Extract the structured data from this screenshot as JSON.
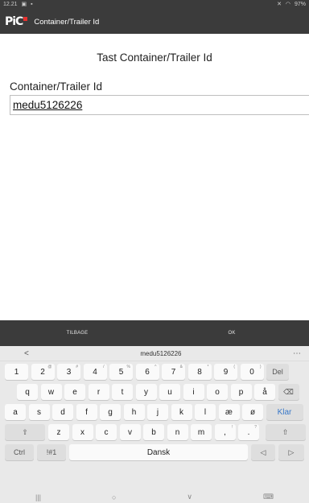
{
  "status_bar": {
    "time": "12.21",
    "left_icons": [
      "picture-icon",
      "image-icon"
    ],
    "right_icons": [
      "mute-icon",
      "wifi-icon"
    ],
    "battery": "97%"
  },
  "app_bar": {
    "logo_text": "PiC",
    "title": "Container/Trailer Id"
  },
  "main": {
    "heading": "Tast Container/Trailer Id",
    "field_label": "Container/Trailer Id",
    "field_value": "medu5126226"
  },
  "actions": {
    "back_label": "TILBAGE",
    "ok_label": "OK"
  },
  "keyboard": {
    "suggestion": "medu5126226",
    "suggest_back": "<",
    "suggest_more": "⋯",
    "row1": [
      {
        "k": "1",
        "s": ""
      },
      {
        "k": "2",
        "s": "@"
      },
      {
        "k": "3",
        "s": "#"
      },
      {
        "k": "4",
        "s": "/"
      },
      {
        "k": "5",
        "s": "%"
      },
      {
        "k": "6",
        "s": "^"
      },
      {
        "k": "7",
        "s": "&"
      },
      {
        "k": "8",
        "s": "*"
      },
      {
        "k": "9",
        "s": "("
      },
      {
        "k": "0",
        "s": ")"
      }
    ],
    "row1_del": "Del",
    "row2": [
      "q",
      "w",
      "e",
      "r",
      "t",
      "y",
      "u",
      "i",
      "o",
      "p",
      "å"
    ],
    "row2_backspace": "⌫",
    "row3": [
      "a",
      "s",
      "d",
      "f",
      "g",
      "h",
      "j",
      "k",
      "l",
      "æ",
      "ø"
    ],
    "row3_enter": "Klar",
    "row4_shift": "⇧",
    "row4": [
      "z",
      "x",
      "c",
      "v",
      "b",
      "n",
      "m"
    ],
    "row4_punct": [
      {
        "k": ",",
        "s": "!"
      },
      {
        "k": ".",
        "s": "?"
      }
    ],
    "row5_ctrl": "Ctrl",
    "row5_sym": "!#1",
    "space_label": "Dansk",
    "arrow_left": "◁",
    "arrow_right": "▷"
  },
  "nav_bar": {
    "recents": "|||",
    "home": "○",
    "back": "∨",
    "keyboard": "⌨"
  }
}
